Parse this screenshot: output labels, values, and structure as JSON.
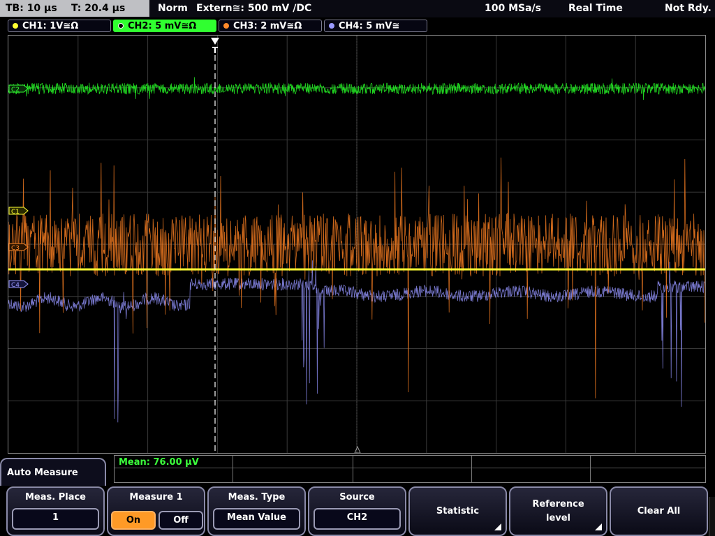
{
  "topbar": {
    "timebase": "TB: 10 µs",
    "trigger_time": "T: 20.4 µs",
    "trigger_mode": "Norm",
    "trigger_source": "Extern≅: 500 mV ∕DC",
    "sample_rate": "100 MSa/s",
    "acq_mode": "Real Time",
    "status": "Not Rdy."
  },
  "channels": [
    {
      "label": "CH1: 1V≅Ω",
      "color": "#ffff33",
      "active": false
    },
    {
      "label": "CH2: 5 mV≅Ω",
      "color": "#33ff33",
      "active": true
    },
    {
      "label": "CH3: 2 mV≅Ω",
      "color": "#ff8a2a",
      "active": false
    },
    {
      "label": "CH4: 5 mV≅",
      "color": "#9a9aff",
      "active": false
    }
  ],
  "markers": {
    "c1": "C1",
    "c2": "C2",
    "c3": "C3",
    "c4": "C4",
    "trigger": "T"
  },
  "measurement": {
    "readout": "Mean: 76.00 µV"
  },
  "menu": {
    "title": "Auto Measure",
    "meas_place_title": "Meas. Place",
    "meas_place_value": "1",
    "measure1_title": "Measure 1",
    "on_label": "On",
    "off_label": "Off",
    "meas_type_title": "Meas. Type",
    "meas_type_value": "Mean Value",
    "source_title": "Source",
    "source_value": "CH2",
    "statistic_label": "Statistic",
    "reference_label_1": "Reference",
    "reference_label_2": "level",
    "clear_all_label": "Clear All"
  },
  "colors": {
    "ch1": "#ffff33",
    "ch2": "#22dd22",
    "ch3": "#e8761f",
    "ch4": "#8c8cf0",
    "grid": "#3a3a3a"
  }
}
